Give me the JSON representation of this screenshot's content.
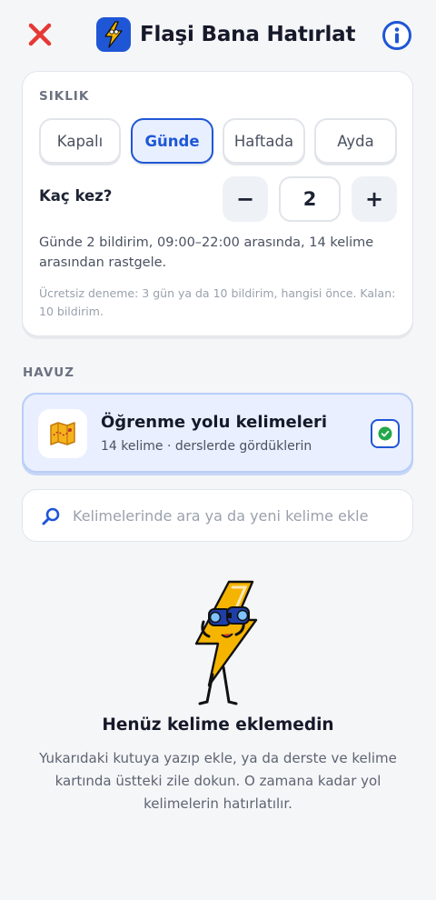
{
  "header": {
    "title": "Flaşi Bana Hatırlat",
    "close_icon": "close-x-icon",
    "info_icon": "info-icon",
    "app_icon": "lightning-mascot-icon"
  },
  "frequency": {
    "section_label": "SIKLIK",
    "options": [
      "Kapalı",
      "Günde",
      "Haftada",
      "Ayda"
    ],
    "selected": "Günde",
    "count_label": "Kaç kez?",
    "minus_label": "−",
    "plus_label": "+",
    "count_value": "2",
    "summary": "Günde 2 bildirim, 09:00–22:00 arasında, 14 kelime arasından rastgele.",
    "trial_note": "Ücretsiz deneme: 3 gün ya da 10 bildirim, hangisi önce. Kalan: 10 bildirim."
  },
  "pool": {
    "section_label": "HAVUZ",
    "item": {
      "title": "Öğrenme yolu kelimeleri",
      "subtitle": "14 kelime · derslerde gördüklerin",
      "icon": "map-icon",
      "checked": true
    }
  },
  "search": {
    "placeholder": "Kelimelerinde ara ya da yeni kelime ekle",
    "value": ""
  },
  "empty_state": {
    "title": "Henüz kelime eklemedin",
    "text": "Yukarıdaki kutuya yazıp ekle, ya da derste ve kelime kartında üstteki zile dokun. O zamana kadar yol kelimelerin hatırlatılır."
  },
  "colors": {
    "accent": "#1f56d6",
    "close_red": "#e53935",
    "mascot_yellow": "#f5b400"
  }
}
